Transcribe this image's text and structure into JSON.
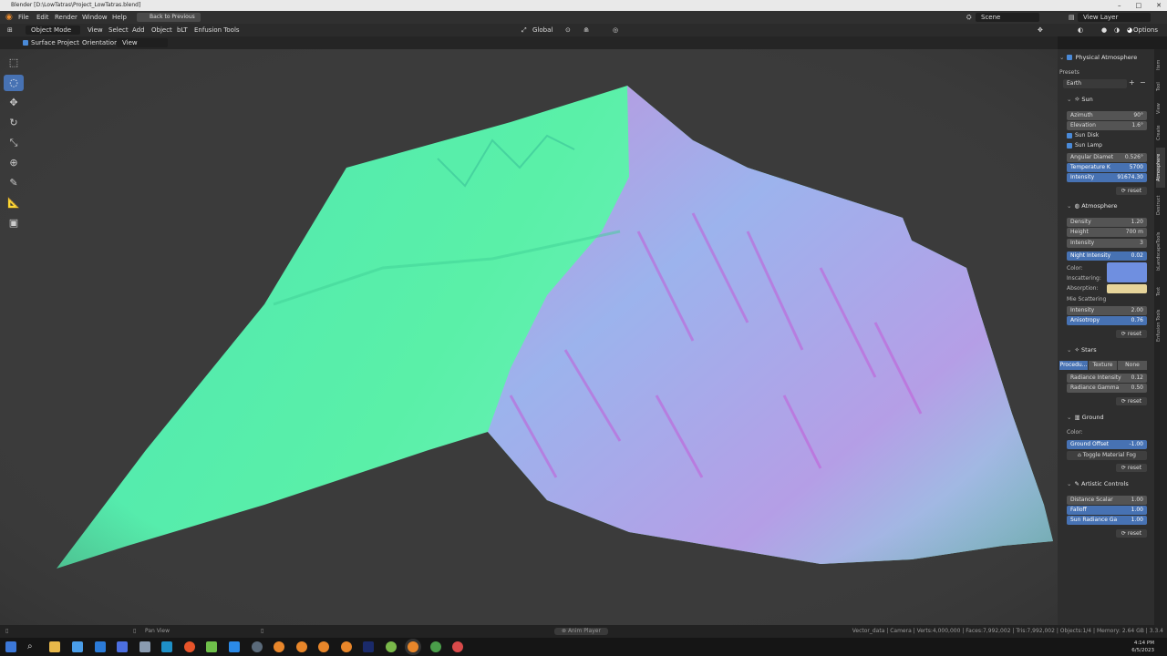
{
  "window": {
    "title": "Blender [D:\\LowTatras\\Project_LowTatras.blend]",
    "controls": [
      "–",
      "□",
      "✕"
    ]
  },
  "menubar": {
    "items": [
      "File",
      "Edit",
      "Render",
      "Window",
      "Help"
    ],
    "back_label": "Back to Previous",
    "scene_label": "Scene",
    "view_layer_label": "View Layer"
  },
  "header": {
    "mode": "Object Mode",
    "menus": [
      "View",
      "Select",
      "Add",
      "Object",
      "bLT",
      "Enfusion Tools"
    ],
    "transform_orientation": "Global",
    "options": "Options"
  },
  "tool_options": {
    "surface_project": "Surface Project",
    "orientation_label": "Orientation:",
    "orientation_value": "View"
  },
  "npanel": {
    "physical_atmosphere": "Physical Atmosphere",
    "presets_label": "Presets",
    "preset_value": "Earth",
    "sun": {
      "title": "Sun",
      "azimuth": {
        "label": "Azimuth",
        "value": "90°"
      },
      "elevation": {
        "label": "Elevation",
        "value": "1.6°"
      },
      "sun_disk": "Sun Disk",
      "sun_lamp": "Sun Lamp",
      "angular_diameter": {
        "label": "Angular Diamet",
        "value": "0.526°"
      },
      "temperature": {
        "label": "Temperature K",
        "value": "5700"
      },
      "intensity": {
        "label": "Intensity",
        "value": "91674.30"
      }
    },
    "atmosphere": {
      "title": "Atmosphere",
      "density": {
        "label": "Density",
        "value": "1.20"
      },
      "height": {
        "label": "Height",
        "value": "700 m"
      },
      "intensity": {
        "label": "Intensity",
        "value": "3"
      },
      "night_intensity": {
        "label": "Night Intensity",
        "value": "0.02"
      },
      "color_label": "Color:",
      "inscattering_label": "Inscattering:",
      "absorption_label": "Absorption:",
      "mie_label": "Mie Scattering",
      "mie_intensity": {
        "label": "Intensity",
        "value": "2.00"
      },
      "anisotropy": {
        "label": "Anisotropy",
        "value": "0.76"
      }
    },
    "stars": {
      "title": "Stars",
      "modes": [
        "Procedu...",
        "Texture",
        "None"
      ],
      "radiance_intensity": {
        "label": "Radiance Intensity",
        "value": "0.12"
      },
      "radiance_gamma": {
        "label": "Radiance Gamma",
        "value": "0.50"
      }
    },
    "ground": {
      "title": "Ground",
      "color_label": "Color:",
      "ground_offset": {
        "label": "Ground Offset",
        "value": "-1.00"
      },
      "toggle_fog": "Toggle Material Fog"
    },
    "artistic": {
      "title": "Artistic Controls",
      "distance_scalar": {
        "label": "Distance Scalar",
        "value": "1.00"
      },
      "falloff": {
        "label": "Falloff",
        "value": "1.00"
      },
      "sun_radiance_gamma": {
        "label": "Sun Radiance Ga",
        "value": "1.00"
      }
    },
    "reset_label": "reset"
  },
  "side_tabs": [
    "Item",
    "Tool",
    "View",
    "Create",
    "Atmosphere",
    "Destruct",
    "bLandscapeTools",
    "Text",
    "Enfusion Tools"
  ],
  "statusbar": {
    "left": "Pan View",
    "center": "Anim Player",
    "right": "Vector_data | Camera | Verts:4,000,000 | Faces:7,992,002 | Tris:7,992,002 | Objects:1/4 | Memory: 2.64 GB | 3.3.4"
  },
  "taskbar": {
    "time": "4:14 PM",
    "date": "6/5/2023"
  },
  "colors": {
    "accent": "#4772b3",
    "inscattering_swatch": "#6f8fe0",
    "absorption_swatch": "#e6d49a"
  }
}
